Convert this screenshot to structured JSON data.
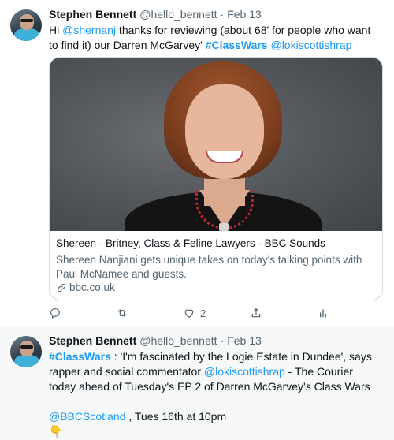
{
  "tweets": [
    {
      "author_name": "Stephen Bennett",
      "handle": "@hello_bennett",
      "separator": "·",
      "date": "Feb 13",
      "text": {
        "p1": "Hi ",
        "mention1": "@shernanj",
        "p2": " thanks for reviewing  (about 68' for people who want to find it) our Darren McGarvey' ",
        "hashtag1": "#ClassWars",
        "p3": " ",
        "mention2": "@lokiscottishrap"
      },
      "card": {
        "title": "Shereen - Britney, Class & Feline Lawyers - BBC Sounds",
        "description": "Shereen Nanjiani gets unique takes on today's talking points with Paul McNamee and guests.",
        "domain": "bbc.co.uk",
        "image_alt": "Shereen Nanjiani portrait"
      },
      "actions": {
        "reply_icon": "reply-icon",
        "retweet_icon": "retweet-icon",
        "like_icon": "heart-icon",
        "like_count": "2",
        "share_icon": "share-icon",
        "analytics_icon": "analytics-icon"
      }
    },
    {
      "author_name": "Stephen Bennett",
      "handle": "@hello_bennett",
      "separator": "·",
      "date": "Feb 13",
      "text": {
        "hashtag1": "#ClassWars",
        "p1": " : 'I'm fascinated by the Logie Estate in Dundee', says rapper and social commentator ",
        "mention1": "@lokiscottishrap",
        "p2": " - The Courier today ahead of Tuesday's EP 2 of Darren McGarvey's Class Wars",
        "mention2": "@BBCScotland",
        "p3": " , Tues 16th at 10pm",
        "emoji": "👇"
      }
    }
  ],
  "colors": {
    "accent": "#1d9bf0",
    "muted": "#536471",
    "text": "#0f1419",
    "selected_bg": "#f7f9f9"
  }
}
